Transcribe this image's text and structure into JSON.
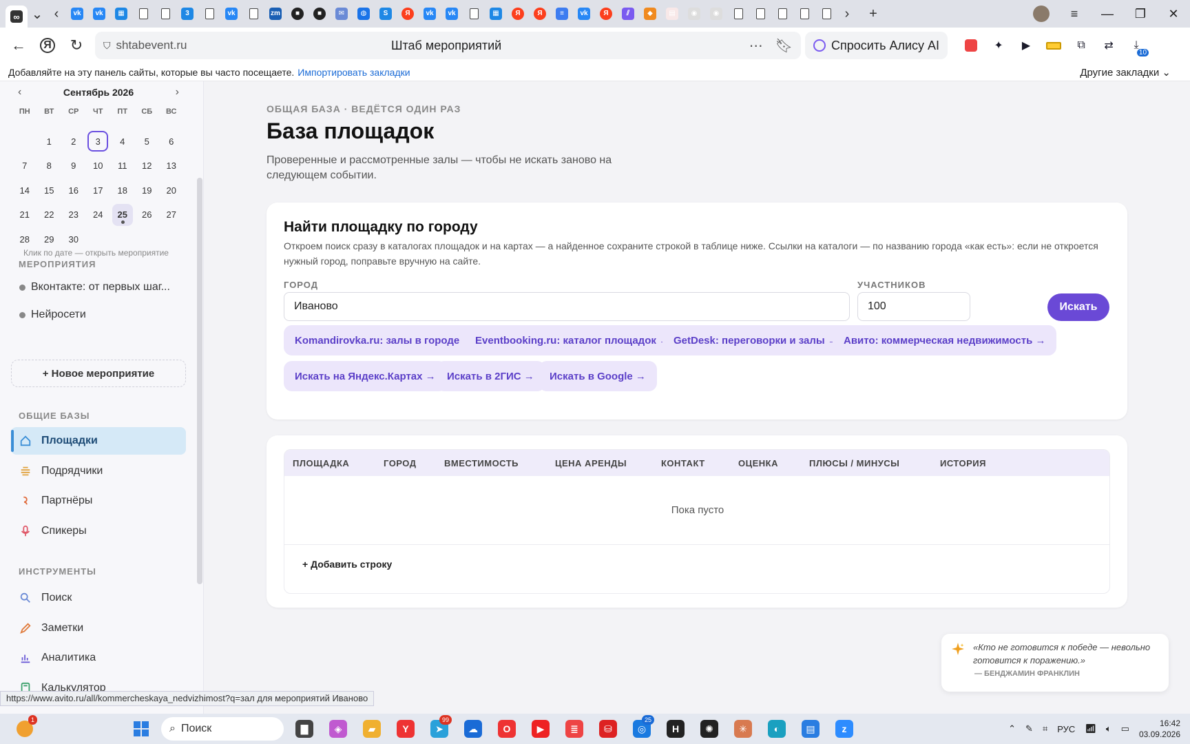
{
  "browser": {
    "tab_favicons": [
      "infinity-icon",
      "vk-icon",
      "vk-icon",
      "grid-icon",
      "doc-icon",
      "doc-icon",
      "3-icon",
      "doc-icon",
      "vk-icon",
      "doc-icon",
      "zm-icon",
      "dark-icon",
      "dark-icon",
      "mail-icon",
      "globe-icon",
      "s-icon",
      "ya-icon",
      "vk-icon",
      "vk-icon",
      "doc-icon",
      "grid-icon",
      "ya-icon",
      "ya-icon",
      "docs-icon",
      "vk-icon",
      "ya-icon",
      "stripes-icon",
      "mango-icon",
      "pdf-icon",
      "robot-icon",
      "robot-icon",
      "doc-icon",
      "doc-icon",
      "doc-icon",
      "doc-icon",
      "doc-icon"
    ],
    "url": "shtabevent.ru",
    "page_title": "Штаб мероприятий",
    "alice_label": "Спросить Алису AI",
    "ext_badge": "10",
    "bookmarks_hint": "Добавляйте на эту панель сайты, которые вы часто посещаете.",
    "bookmarks_import": "Импортировать закладки",
    "bookmarks_other": "Другие закладки",
    "status_url": "https://www.avito.ru/all/kommercheskaya_nedvizhimost?q=зал для мероприятий Иваново"
  },
  "calendar": {
    "month": "Сентябрь 2026",
    "weekdays": [
      "ПН",
      "ВТ",
      "СР",
      "ЧТ",
      "ПТ",
      "СБ",
      "ВС"
    ],
    "days": [
      "",
      "1",
      "2",
      "3",
      "4",
      "5",
      "6",
      "7",
      "8",
      "9",
      "10",
      "11",
      "12",
      "13",
      "14",
      "15",
      "16",
      "17",
      "18",
      "19",
      "20",
      "21",
      "22",
      "23",
      "24",
      "25",
      "26",
      "27",
      "28",
      "29",
      "30"
    ],
    "today": "3",
    "selected": "25",
    "hint": "Клик по дате — открыть мероприятие"
  },
  "sidebar": {
    "events_title": "МЕРОПРИЯТИЯ",
    "events": [
      "Вконтакте: от первых шаг...",
      "Нейросети"
    ],
    "new_event": "+ Новое мероприятие",
    "bases_title": "ОБЩИЕ БАЗЫ",
    "bases": [
      {
        "label": "Площадки",
        "icon": "home-icon",
        "color": "#3a8ed6"
      },
      {
        "label": "Подрядчики",
        "icon": "layers-icon",
        "color": "#e0a13a"
      },
      {
        "label": "Партнёры",
        "icon": "partner-icon",
        "color": "#e06a3a"
      },
      {
        "label": "Спикеры",
        "icon": "mic-icon",
        "color": "#e05a6a"
      }
    ],
    "tools_title": "ИНСТРУМЕНТЫ",
    "tools": [
      {
        "label": "Поиск",
        "icon": "search-icon",
        "color": "#6a8ad6"
      },
      {
        "label": "Заметки",
        "icon": "pencil-icon",
        "color": "#e07a3a"
      },
      {
        "label": "Аналитика",
        "icon": "chart-icon",
        "color": "#6a5ad6"
      },
      {
        "label": "Калькулятор",
        "icon": "calculator-icon",
        "color": "#3aa06a"
      }
    ]
  },
  "main": {
    "eyebrow": "ОБЩАЯ БАЗА · ВЕДЁТСЯ ОДИН РАЗ",
    "title": "База площадок",
    "lead": "Проверенные и рассмотренные залы — чтобы не искать заново на следующем событии.",
    "search": {
      "title": "Найти площадку по городу",
      "desc": "Откроем поиск сразу в каталогах площадок и на картах — а найденное сохраните строкой в таблице ниже. Ссылки на каталоги — по названию города «как есть»: если не откроется нужный город, поправьте вручную на сайте.",
      "city_label": "ГОРОД",
      "city_value": "Иваново",
      "guests_label": "УЧАСТНИКОВ",
      "guests_value": "100",
      "button": "Искать",
      "links": [
        "Komandirovka.ru: залы в городе →",
        "Eventbooking.ru: каталог площадок →",
        "GetDesk: переговорки и залы →",
        "Авито: коммерческая недвижимость →",
        "Искать на Яндекс.Картах →",
        "Искать в 2ГИС →",
        "Искать в Google →"
      ]
    },
    "table": {
      "columns": [
        "ПЛОЩАДКА",
        "ГОРОД",
        "ВМЕСТИМОСТЬ",
        "ЦЕНА АРЕНДЫ",
        "КОНТАКТ",
        "ОЦЕНКА",
        "ПЛЮСЫ / МИНУСЫ",
        "ИСТОРИЯ"
      ],
      "empty": "Пока пусто",
      "add_row": "+ Добавить строку"
    },
    "quote": {
      "text": "«Кто не готовится к победе — невольно готовится к поражению.»",
      "author": "— БЕНДЖАМИН ФРАНКЛИН"
    }
  },
  "taskbar": {
    "search": "Поиск",
    "lang": "РУС",
    "time": "16:42",
    "date": "03.09.2026",
    "notif_badge": "1",
    "tg_badge": "99",
    "app_badge": "25"
  }
}
